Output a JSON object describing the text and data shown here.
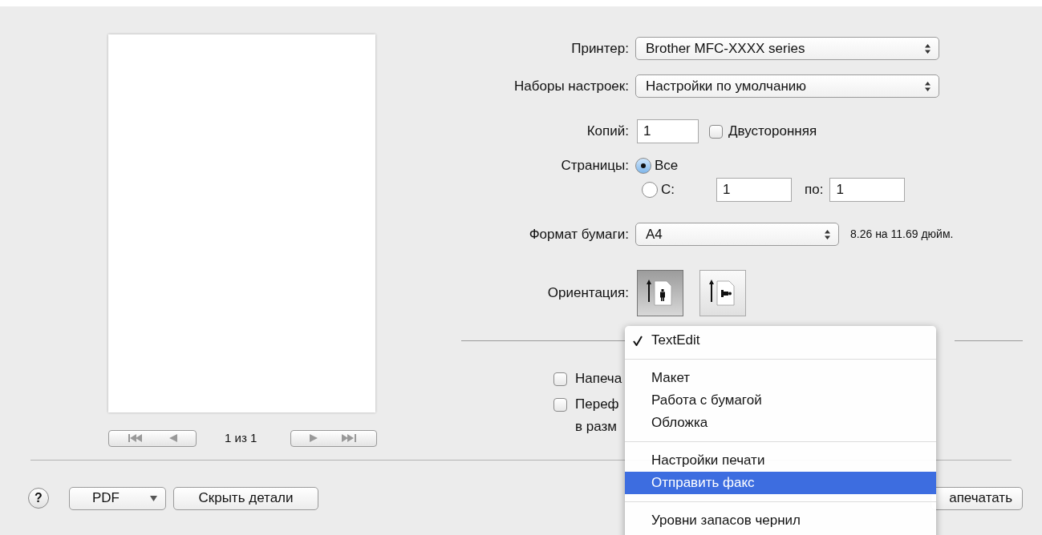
{
  "preview": {
    "page_label": "1 из 1"
  },
  "form": {
    "printer": {
      "label": "Принтер:",
      "value": "Brother MFC-XXXX series"
    },
    "presets": {
      "label": "Наборы настроек:",
      "value": "Настройки по умолчанию"
    },
    "copies": {
      "label": "Копий:",
      "value": "1"
    },
    "duplex": {
      "label": "Двусторонняя",
      "checked": false
    },
    "pages": {
      "label": "Страницы:",
      "options": [
        {
          "label": "Все",
          "selected": true
        },
        {
          "label": "С:",
          "selected": false
        }
      ],
      "from": "1",
      "to_label": "по:",
      "to": "1"
    },
    "paper": {
      "label": "Формат бумаги:",
      "value": "A4",
      "size": "8.26 на 11.69 дюйм."
    },
    "orientation": {
      "label": "Ориентация:",
      "options": [
        {
          "kind": "portrait",
          "selected": true
        },
        {
          "kind": "landscape",
          "selected": false
        }
      ]
    }
  },
  "options": [
    {
      "lines": [
        "Напеча"
      ],
      "checked": false
    },
    {
      "lines": [
        "Переф",
        "в разм"
      ],
      "checked": false
    }
  ],
  "menu": {
    "items": [
      {
        "kind": "item",
        "label": "TextEdit",
        "checked": true,
        "selected": false
      },
      {
        "kind": "separator"
      },
      {
        "kind": "item",
        "label": "Макет",
        "checked": false,
        "selected": false
      },
      {
        "kind": "item",
        "label": "Работа с бумагой",
        "checked": false,
        "selected": false
      },
      {
        "kind": "item",
        "label": "Обложка",
        "checked": false,
        "selected": false
      },
      {
        "kind": "separator"
      },
      {
        "kind": "item",
        "label": "Настройки печати",
        "checked": false,
        "selected": false
      },
      {
        "kind": "item",
        "label": "Отправить факс",
        "checked": false,
        "selected": true
      },
      {
        "kind": "separator"
      },
      {
        "kind": "item",
        "label": "Уровни запасов чернил",
        "checked": false,
        "selected": false
      }
    ]
  },
  "footer": {
    "help": "?",
    "pdf": "PDF",
    "hide": "Скрыть детали",
    "print": "апечатать"
  }
}
